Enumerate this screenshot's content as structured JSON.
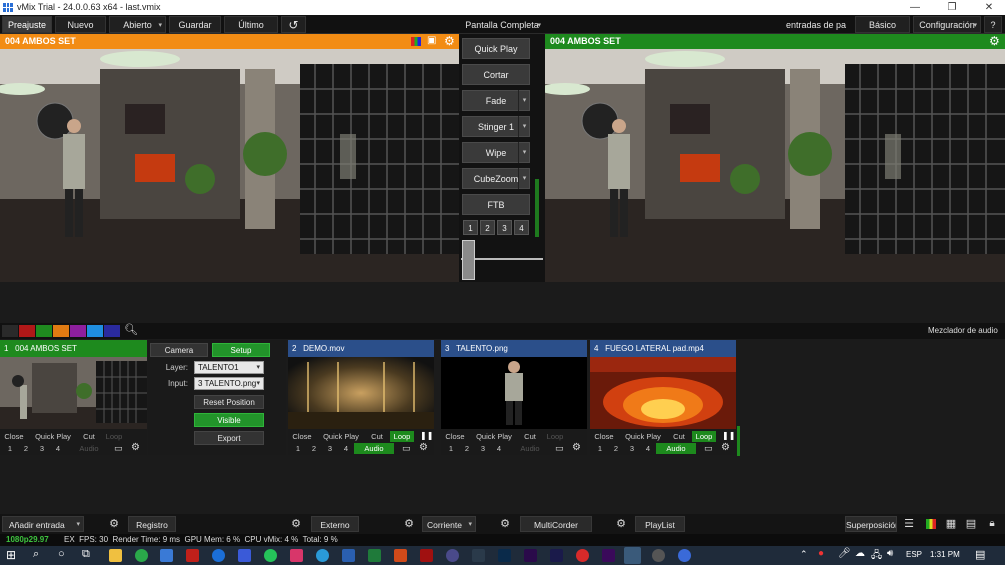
{
  "window": {
    "title": "vMix Trial - 24.0.0.63 x64 - last.vmix"
  },
  "menu": {
    "items": [
      "Preajuste",
      "Nuevo",
      "Abierto",
      "Guardar",
      "Último"
    ],
    "center_label": "Pantalla Completa",
    "right_items": [
      "entradas de pa",
      "Básico",
      "Configuración",
      "?"
    ]
  },
  "preview": {
    "title": "004 AMBOS SET",
    "color": "#f28c14"
  },
  "output": {
    "title": "004 AMBOS SET",
    "color": "#1e8a1e"
  },
  "transitions": {
    "buttons": [
      "Quick Play",
      "Cortar",
      "Fade",
      "Stinger 1",
      "Wipe",
      "CubeZoom",
      "FTB"
    ],
    "numbers": [
      "1",
      "2",
      "3",
      "4"
    ]
  },
  "colors": {
    "swatches": [
      "#2a2a2a",
      "#b01818",
      "#1f8a1f",
      "#e07b12",
      "#8e1f9e",
      "#1f8ee0",
      "#2a2a9e"
    ]
  },
  "mixer_label": "Mezclador de audio",
  "inputs": [
    {
      "num": "1",
      "name": "004 AMBOS SET",
      "color": "#1e8a1e",
      "audio": "Audio",
      "audio_on": false,
      "loop_on": false
    },
    {
      "num": "2",
      "name": "DEMO.mov",
      "color": "#2b4f8a",
      "audio": "Audio",
      "audio_on": true,
      "loop_on": true
    },
    {
      "num": "3",
      "name": "TALENTO.png",
      "color": "#2b4f8a",
      "audio": "Audio",
      "audio_on": false,
      "loop_on": false
    },
    {
      "num": "4",
      "name": "FUEGO LATERAL pad.mp4",
      "color": "#2b4f8a",
      "audio": "Audio",
      "audio_on": true,
      "loop_on": true
    }
  ],
  "card_controls": {
    "close": "Close",
    "quickplay": "Quick Play",
    "cut": "Cut",
    "loop": "Loop",
    "n1": "1",
    "n2": "2",
    "n3": "3",
    "n4": "4"
  },
  "setup": {
    "camera": "Camera",
    "setup": "Setup",
    "layer_label": "Layer:",
    "layer_value": "TALENTO1",
    "input_label": "Input:",
    "input_value": "3 TALENTO.png",
    "reset": "Reset Position",
    "visible": "Visible",
    "export": "Export"
  },
  "bottom": {
    "add_input": "Añadir entrada",
    "registro": "Registro",
    "externo": "Externo",
    "corriente": "Corriente",
    "multicorder": "MultiCorder",
    "playlist": "PlayList",
    "superposicion": "Superposición"
  },
  "status": {
    "format": "1080p29.97",
    "text": "EX  FPS: 30  Render Time: 9 ms  GPU Mem: 6 %  CPU vMix: 4 %  Total: 9 %"
  },
  "taskbar": {
    "lang": "ESP",
    "time": "1:31 PM"
  }
}
